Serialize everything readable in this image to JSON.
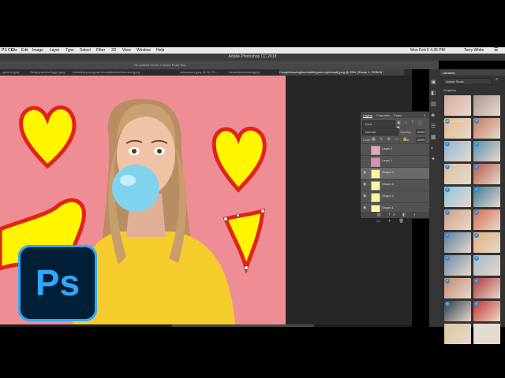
{
  "menubar": {
    "apple": "",
    "items": [
      "PS CC",
      "File",
      "Edit",
      "Image",
      "Layer",
      "Type",
      "Select",
      "Filter",
      "3D",
      "View",
      "Window",
      "Help"
    ],
    "clock": "Mon Feb 5  4:35 PM",
    "user": "Terry White"
  },
  "app_title": "Adobe Photoshop CC 2018",
  "options_bar": {
    "message": "No options for the Convert Point Tool."
  },
  "tabs": [
    "...ground.jpeg",
    "Gizapyramids Egypt.jpeg",
    "Attractiveyoungman'sheadshot&refinement.jpeg",
    "oldcamera.jpeg @ 16.7%...",
    "romantictoreview.jpeg",
    "Cowgirlblowingbluebubblegumnorpinkwall.jpeg @ 25% (Shape 4, RGB/8) *"
  ],
  "active_tab_index": 5,
  "layers_panel": {
    "tabs": [
      "Layers",
      "Channels",
      "Paths"
    ],
    "active_tab": "Layers",
    "kind_label": "Kind",
    "blend_mode": "Normal",
    "opacity_label": "Opacity:",
    "opacity": "100%",
    "lock_label": "Lock:",
    "fill_label": "Fill:",
    "fill": "100%",
    "layers": [
      {
        "name": "Layer 2",
        "visible": false,
        "selected": false
      },
      {
        "name": "Layer 1",
        "visible": false,
        "selected": false
      },
      {
        "name": "Shape 4",
        "visible": true,
        "selected": true
      },
      {
        "name": "Shape 3",
        "visible": true,
        "selected": false
      },
      {
        "name": "Shape 2",
        "visible": true,
        "selected": false
      },
      {
        "name": "Shape 1",
        "visible": true,
        "selected": false
      }
    ]
  },
  "libraries_panel": {
    "title": "Libraries",
    "library_name": "Adobe Stock",
    "section": "Graphics",
    "caption": "Cute girl blowing...",
    "thumb_colors": [
      "#d9a9a0",
      "#a89a92",
      "#e4b98a",
      "#c67a5e",
      "#8fb7d6",
      "#5a8fb0",
      "#d7c3a0",
      "#b65a4a",
      "#8dc6de",
      "#3a7a9a",
      "#cfa085",
      "#d86b4a",
      "#5b7f9e",
      "#e1b07a",
      "#6f8aa8",
      "#a7b7c7",
      "#c48a70",
      "#b23a3a",
      "#2c3e4a",
      "#c9342f",
      "#d9c9a0",
      "#e2ded4"
    ]
  },
  "ps_logo_text": "Ps",
  "colors": {
    "canvas_bg": "#ee8e94",
    "heart_fill": "#fff600",
    "heart_stroke": "#e2231a",
    "ps_blue": "#31a8ff",
    "ps_dark": "#001e36",
    "shirt": "#f6cc2c"
  }
}
